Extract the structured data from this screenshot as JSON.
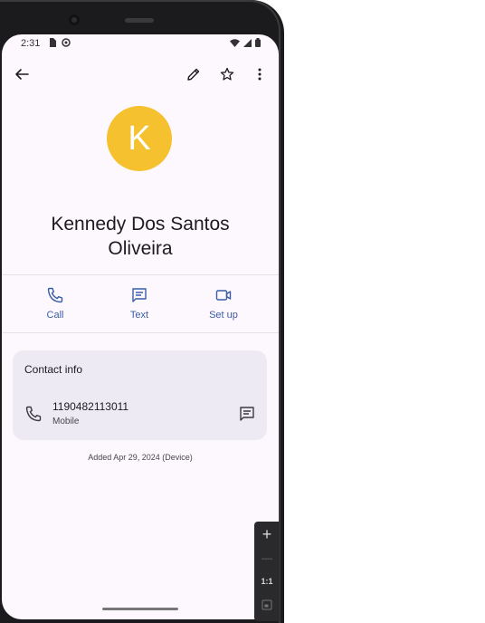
{
  "status_bar": {
    "time": "2:31"
  },
  "toolbar": {
    "back_icon": "arrow-back-icon",
    "edit_icon": "pencil-icon",
    "favorite_icon": "star-outline-icon",
    "more_icon": "more-vert-icon"
  },
  "contact": {
    "initial": "K",
    "avatar_color": "#f6c12f",
    "name": "Kennedy Dos Santos Oliveira"
  },
  "actions": [
    {
      "label": "Call",
      "icon": "phone-icon"
    },
    {
      "label": "Text",
      "icon": "message-icon"
    },
    {
      "label": "Set up",
      "icon": "video-icon"
    }
  ],
  "contact_info": {
    "title": "Contact info",
    "phone_number": "1190482113011",
    "phone_type": "Mobile"
  },
  "added_text": "Added Apr 29, 2024 (Device)",
  "emulator_zoom": {
    "zoom_in": "+",
    "zoom_out": "—",
    "ratio": "1:1"
  },
  "colors": {
    "accent": "#3a5da8",
    "background": "#fdf8fd",
    "card": "#edeaf3"
  }
}
